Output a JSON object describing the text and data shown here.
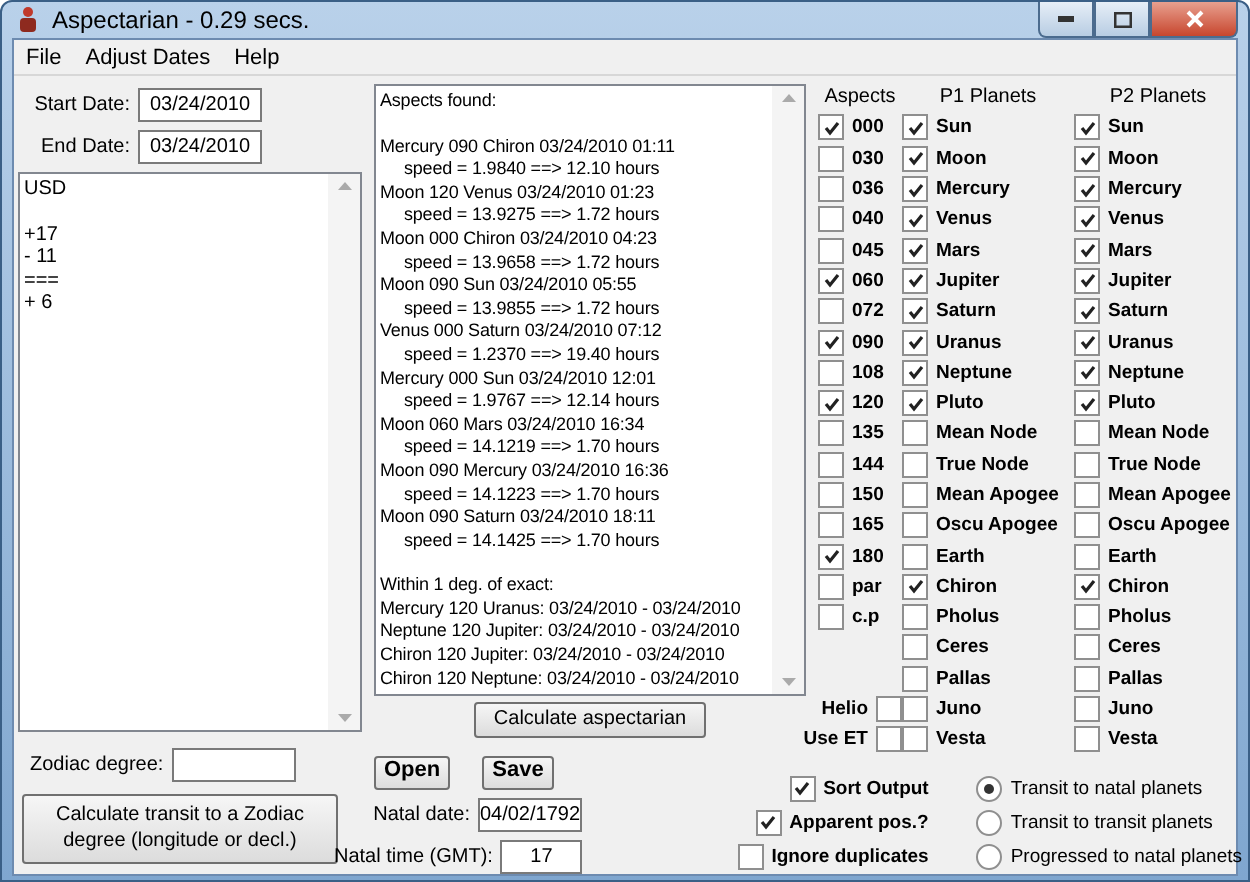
{
  "window": {
    "title": "Aspectarian - 0.29 secs."
  },
  "menu": [
    "File",
    "Adjust Dates",
    "Help"
  ],
  "start_date": {
    "label": "Start Date:",
    "value": "03/24/2010"
  },
  "end_date": {
    "label": "End Date:",
    "value": "03/24/2010"
  },
  "notes": {
    "header": "USD",
    "lines": [
      "+17",
      "- 11",
      "===",
      "+ 6"
    ]
  },
  "zodiac_degree": {
    "label": "Zodiac degree:"
  },
  "zodiac_button": {
    "label": "Calculate transit to a Zodiac degree (longitude or decl.)"
  },
  "results": {
    "heading": "Aspects found:",
    "aspects": [
      {
        "event": "Mercury 090 Chiron 03/24/2010 01:11",
        "speed": "speed = 1.9840 ==> 12.10 hours"
      },
      {
        "event": "Moon 120 Venus 03/24/2010 01:23",
        "speed": "speed = 13.9275 ==> 1.72 hours"
      },
      {
        "event": "Moon 000 Chiron 03/24/2010 04:23",
        "speed": "speed = 13.9658 ==> 1.72 hours"
      },
      {
        "event": "Moon 090 Sun 03/24/2010 05:55",
        "speed": "speed = 13.9855 ==> 1.72 hours"
      },
      {
        "event": "Venus 000 Saturn 03/24/2010 07:12",
        "speed": "speed = 1.2370 ==> 19.40 hours"
      },
      {
        "event": "Mercury 000 Sun 03/24/2010 12:01",
        "speed": "speed = 1.9767 ==> 12.14 hours"
      },
      {
        "event": "Moon 060 Mars 03/24/2010 16:34",
        "speed": "speed = 14.1219 ==> 1.70 hours"
      },
      {
        "event": "Moon 090 Mercury 03/24/2010 16:36",
        "speed": "speed = 14.1223 ==> 1.70 hours"
      },
      {
        "event": "Moon 090 Saturn 03/24/2010 18:11",
        "speed": "speed = 14.1425 ==> 1.70 hours"
      }
    ],
    "within_heading": "Within 1 deg. of exact:",
    "within": [
      "Mercury 120 Uranus: 03/24/2010 - 03/24/2010",
      "Neptune 120 Jupiter: 03/24/2010 - 03/24/2010",
      "Chiron 120 Jupiter: 03/24/2010 - 03/24/2010",
      "Chiron 120 Neptune: 03/24/2010 - 03/24/2010"
    ]
  },
  "calculate_button": {
    "label": "Calculate aspectarian"
  },
  "open_button": {
    "label": "Open"
  },
  "save_button": {
    "label": "Save"
  },
  "natal_date": {
    "label": "Natal date:",
    "value": "04/02/1792"
  },
  "natal_time": {
    "label": "Natal time (GMT):",
    "value": "17"
  },
  "headers": {
    "aspects": "Aspects",
    "p1": "P1 Planets",
    "p2": "P2 Planets"
  },
  "aspects": [
    {
      "label": "000",
      "checked": true
    },
    {
      "label": "030",
      "checked": false
    },
    {
      "label": "036",
      "checked": false
    },
    {
      "label": "040",
      "checked": false
    },
    {
      "label": "045",
      "checked": false
    },
    {
      "label": "060",
      "checked": true
    },
    {
      "label": "072",
      "checked": false
    },
    {
      "label": "090",
      "checked": true
    },
    {
      "label": "108",
      "checked": false
    },
    {
      "label": "120",
      "checked": true
    },
    {
      "label": "135",
      "checked": false
    },
    {
      "label": "144",
      "checked": false
    },
    {
      "label": "150",
      "checked": false
    },
    {
      "label": "165",
      "checked": false
    },
    {
      "label": "180",
      "checked": true
    },
    {
      "label": "par",
      "checked": false
    },
    {
      "label": "c.p",
      "checked": false
    }
  ],
  "p1_planets": [
    {
      "label": "Sun",
      "checked": true
    },
    {
      "label": "Moon",
      "checked": true
    },
    {
      "label": "Mercury",
      "checked": true
    },
    {
      "label": "Venus",
      "checked": true
    },
    {
      "label": "Mars",
      "checked": true
    },
    {
      "label": "Jupiter",
      "checked": true
    },
    {
      "label": "Saturn",
      "checked": true
    },
    {
      "label": "Uranus",
      "checked": true
    },
    {
      "label": "Neptune",
      "checked": true
    },
    {
      "label": "Pluto",
      "checked": true
    },
    {
      "label": "Mean Node",
      "checked": false
    },
    {
      "label": "True Node",
      "checked": false
    },
    {
      "label": "Mean Apogee",
      "checked": false
    },
    {
      "label": "Oscu Apogee",
      "checked": false
    },
    {
      "label": "Earth",
      "checked": false
    },
    {
      "label": "Chiron",
      "checked": true
    },
    {
      "label": "Pholus",
      "checked": false
    },
    {
      "label": "Ceres",
      "checked": false
    },
    {
      "label": "Pallas",
      "checked": false
    },
    {
      "label": "Juno",
      "checked": false
    },
    {
      "label": "Vesta",
      "checked": false
    }
  ],
  "p2_planets": [
    {
      "label": "Sun",
      "checked": true
    },
    {
      "label": "Moon",
      "checked": true
    },
    {
      "label": "Mercury",
      "checked": true
    },
    {
      "label": "Venus",
      "checked": true
    },
    {
      "label": "Mars",
      "checked": true
    },
    {
      "label": "Jupiter",
      "checked": true
    },
    {
      "label": "Saturn",
      "checked": true
    },
    {
      "label": "Uranus",
      "checked": true
    },
    {
      "label": "Neptune",
      "checked": true
    },
    {
      "label": "Pluto",
      "checked": true
    },
    {
      "label": "Mean Node",
      "checked": false
    },
    {
      "label": "True Node",
      "checked": false
    },
    {
      "label": "Mean Apogee",
      "checked": false
    },
    {
      "label": "Oscu Apogee",
      "checked": false
    },
    {
      "label": "Earth",
      "checked": false
    },
    {
      "label": "Chiron",
      "checked": true
    },
    {
      "label": "Pholus",
      "checked": false
    },
    {
      "label": "Ceres",
      "checked": false
    },
    {
      "label": "Pallas",
      "checked": false
    },
    {
      "label": "Juno",
      "checked": false
    },
    {
      "label": "Vesta",
      "checked": false
    }
  ],
  "helio": {
    "label": "Helio",
    "checked": false
  },
  "use_et": {
    "label": "Use ET",
    "checked": false
  },
  "options": [
    {
      "label": "Sort Output",
      "checked": true
    },
    {
      "label": "Apparent pos.?",
      "checked": true
    },
    {
      "label": "Ignore duplicates",
      "checked": false
    }
  ],
  "modes": [
    {
      "label": "Transit to natal planets",
      "selected": true
    },
    {
      "label": "Transit to transit planets",
      "selected": false
    },
    {
      "label": "Progressed to natal planets",
      "selected": false
    }
  ]
}
